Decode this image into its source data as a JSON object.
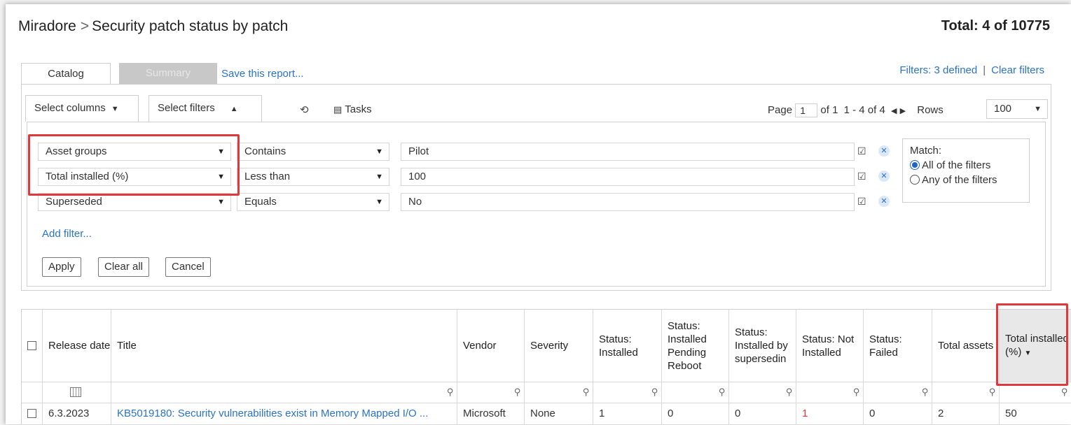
{
  "header": {
    "root": "Miradore",
    "separator": ">",
    "page_title": "Security patch status by patch",
    "total": "Total: 4 of 10775"
  },
  "tabs": [
    {
      "label": "Catalog",
      "active": true
    },
    {
      "label": "Summary",
      "active": false
    }
  ],
  "save_report_label": "Save this report...",
  "filters_status": {
    "defined": "Filters: 3 defined",
    "divider": "|",
    "clear": "Clear filters"
  },
  "toolbar": {
    "select_columns": "Select columns",
    "select_filters": "Select filters",
    "tasks": "Tasks"
  },
  "pager": {
    "page_label": "Page",
    "page_value": "1",
    "of_pages": "of 1",
    "range": "1 - 4 of 4",
    "rows_label": "Rows",
    "rows_value": "100"
  },
  "filters": [
    {
      "field": "Asset groups",
      "operator": "Contains",
      "value": "Pilot",
      "enabled": true
    },
    {
      "field": "Total installed (%)",
      "operator": "Less than",
      "value": "100",
      "enabled": true
    },
    {
      "field": "Superseded",
      "operator": "Equals",
      "value": "No",
      "enabled": true
    }
  ],
  "match": {
    "label": "Match:",
    "options": [
      "All of the filters",
      "Any of the filters"
    ],
    "selected": "All of the filters"
  },
  "add_filter_label": "Add filter...",
  "buttons": {
    "apply": "Apply",
    "clear_all": "Clear all",
    "cancel": "Cancel"
  },
  "table": {
    "columns": [
      "Release date",
      "Title",
      "Vendor",
      "Severity",
      "Status: Installed",
      "Status: Installed Pending Reboot",
      "Status: Installed by supersedin",
      "Status: Not Installed",
      "Status: Failed",
      "Total assets",
      "Total installed (%)"
    ],
    "sorted_column": "Total installed (%)",
    "rows": [
      {
        "release_date": "6.3.2023",
        "title": "KB5019180: Security vulnerabilities exist in Memory Mapped I/O ...",
        "vendor": "Microsoft",
        "severity": "None",
        "installed": "1",
        "pending_reboot": "0",
        "installed_by_superseding": "0",
        "not_installed": "1",
        "failed": "0",
        "total_assets": "2",
        "total_installed_pct": "50"
      }
    ]
  },
  "colors": {
    "link": "#2a73c9",
    "highlight": "#e0383b",
    "radio_selected": "#1f64c4"
  }
}
